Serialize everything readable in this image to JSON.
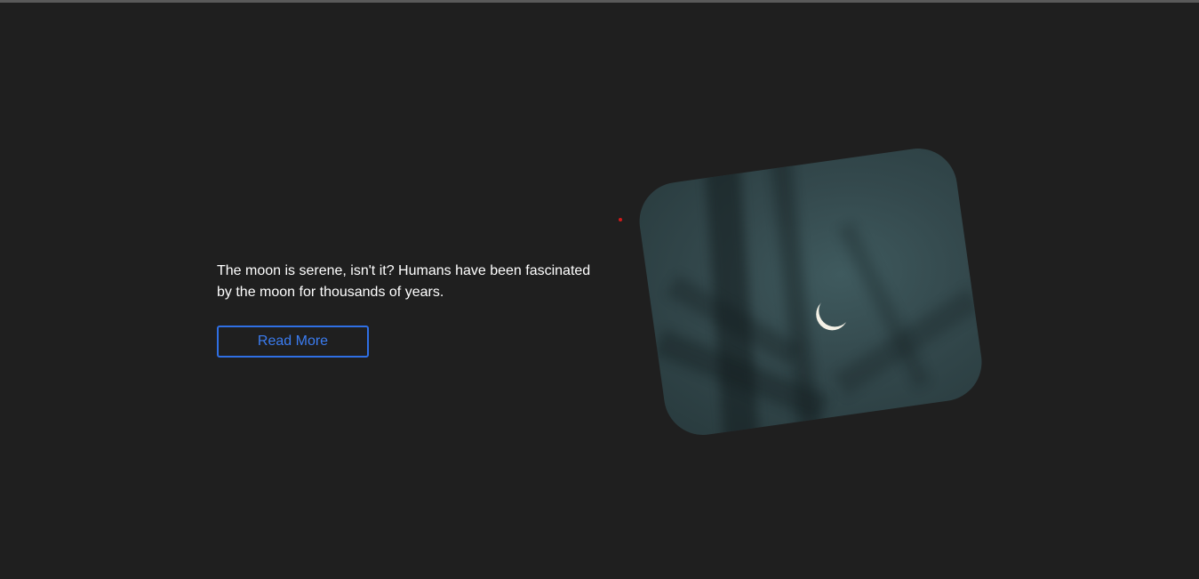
{
  "hero": {
    "text": "The moon is serene, isn't it? Humans have been fascinated by the moon for thousands of years.",
    "button_label": "Read More"
  },
  "colors": {
    "background": "#1f1f1f",
    "accent": "#2f6fe4",
    "text": "#ffffff"
  },
  "image": {
    "subject": "crescent-moon-photo"
  }
}
